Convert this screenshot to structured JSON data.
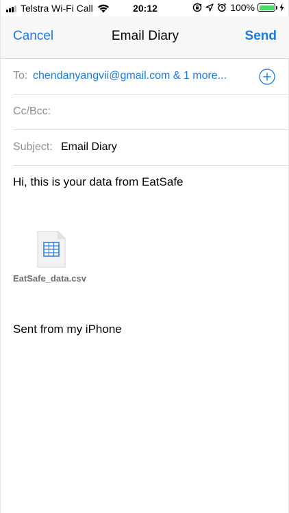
{
  "status_bar": {
    "carrier": "Telstra Wi-Fi Call",
    "time": "20:12",
    "battery_percent": "100%",
    "battery_level": 1.0,
    "icons": [
      "signal-icon",
      "wifi-icon",
      "screen-rotation-lock-icon",
      "location-icon",
      "alarm-icon",
      "battery-icon",
      "charging-icon"
    ]
  },
  "nav": {
    "cancel_label": "Cancel",
    "title": "Email Diary",
    "send_label": "Send"
  },
  "header": {
    "to_label": "To:",
    "to_value": "chendanyangvii@gmail.com & 1 more...",
    "cc_label": "Cc/Bcc:",
    "subject_label": "Subject:",
    "subject_value": "Email Diary"
  },
  "body": {
    "greeting": "Hi, this is your data from EatSafe",
    "attachment_name": "EatSafe_data.csv",
    "signature": "Sent from my iPhone"
  },
  "colors": {
    "accent": "#1a7ae0",
    "label_gray": "#8e8e93",
    "battery_green": "#4cd964"
  }
}
